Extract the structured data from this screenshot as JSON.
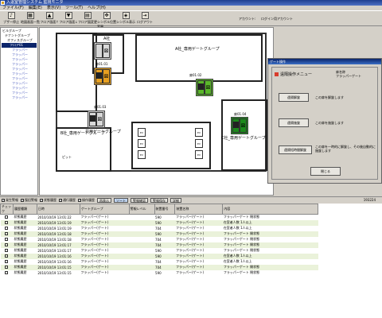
{
  "app": {
    "title": "入退室管理システム 監視モニタ"
  },
  "menu": [
    "ファイル(F)",
    "編集(E)",
    "表示(V)",
    "ツール(T)",
    "ヘルプ(H)"
  ],
  "toolbar": {
    "buttons": [
      "ブザー停止",
      "地図画面一覧",
      "フロア画面↑",
      "フロア画面↓",
      "フロア図変更",
      "シンボル位置変更",
      "シンボル表示",
      "ログアウト"
    ],
    "account_label": "アカウント:",
    "account_value": "ログイン用アカウント"
  },
  "tree": [
    {
      "label": "ビルグループ",
      "indent": 0,
      "selected": false
    },
    {
      "label": "テナントグループ",
      "indent": 1,
      "selected": false
    },
    {
      "label": "オフィスグループ",
      "indent": 2,
      "selected": false
    },
    {
      "label": "フロア01",
      "indent": 3,
      "selected": true
    },
    {
      "label": "フラッパー",
      "indent": 4,
      "selected": false
    },
    {
      "label": "フラッパー",
      "indent": 4,
      "selected": false
    },
    {
      "label": "フラッパー",
      "indent": 4,
      "selected": false
    },
    {
      "label": "フラッパー",
      "indent": 4,
      "selected": false
    },
    {
      "label": "フラッパー",
      "indent": 4,
      "selected": false
    },
    {
      "label": "フラッパー",
      "indent": 4,
      "selected": false
    },
    {
      "label": "フラッパー",
      "indent": 4,
      "selected": false
    },
    {
      "label": "フラッパー",
      "indent": 4,
      "selected": false
    },
    {
      "label": "フラッパー",
      "indent": 4,
      "selected": false
    },
    {
      "label": "フラッパー",
      "indent": 4,
      "selected": false
    },
    {
      "label": "フラッパー",
      "indent": 4,
      "selected": false
    }
  ],
  "map": {
    "labels": {
      "room_a": "A社",
      "group_a": "A社_専用ゲートグループ",
      "group_b": "B社_専用ゲートグループ",
      "group_common": "共用ゲートグループ",
      "group_c": "C社_専用ゲートグループ",
      "pit": "ピット",
      "ev": "EV"
    },
    "gates": [
      {
        "id": "扉01.01",
        "state": "plain"
      },
      {
        "id": "扉01.01",
        "state": "orange"
      },
      {
        "id": "扉01.02",
        "state": "green"
      },
      {
        "id": "扉01.03",
        "state": "plain"
      },
      {
        "id": "扉01.04",
        "state": "dgreen"
      }
    ]
  },
  "dialog": {
    "title": "ゲート操作",
    "heading": "遠隔操作メニュー",
    "gate_label": "扉名称",
    "gate_value": "フラッパーゲート",
    "buttons": [
      {
        "label": "遠隔解錠",
        "desc": "この扉を解錠します"
      },
      {
        "label": "遠隔施錠",
        "desc": "この扉を施錠します"
      },
      {
        "label": "遠隔短時間解錠",
        "desc": "この扉を一時的に解錠し、その後自動的に施錠します"
      }
    ],
    "close": "閉じる"
  },
  "filters": {
    "checks": [
      "発生警報",
      "復旧警報",
      "状態履歴",
      "通行履歴",
      "操作履歴"
    ],
    "buttons": [
      "再表示",
      "ソート",
      "警報確認",
      "警報保存",
      "詳細"
    ],
    "count": "193224"
  },
  "table": {
    "headers": [
      "チェック",
      "履歴種類",
      "日時",
      "ゲートグループ",
      "警報レベル",
      "装置番号",
      "装置名称",
      "内容"
    ],
    "rows": [
      [
        "状態履歴",
        "2010/10/19 13:01:22",
        "フラッパー(ゲート)",
        "",
        "590",
        "フラッパー(ゲート)",
        "フラッパーゲート 閉状態"
      ],
      [
        "状態履歴",
        "2010/10/19 13:01:19",
        "フラッパー(ゲート)",
        "",
        "590",
        "フラッパー(ゲート)",
        "在室者人数 1人以上"
      ],
      [
        "状態履歴",
        "2010/10/19 13:01:19",
        "フラッパー(ゲート)",
        "",
        "704",
        "フラッパー(ゲート)",
        "在室者人数 1人以上"
      ],
      [
        "状態履歴",
        "2010/10/19 13:01:18",
        "フラッパー(ゲート)",
        "",
        "590",
        "フラッパー(ゲート)",
        "フラッパーゲート 開状態"
      ],
      [
        "状態履歴",
        "2010/10/19 13:01:18",
        "フラッパー(ゲート)",
        "",
        "704",
        "フラッパー(ゲート)",
        "フラッパーゲート 閉状態"
      ],
      [
        "状態履歴",
        "2010/10/19 13:01:17",
        "フラッパー(ゲート)",
        "",
        "704",
        "フラッパー(ゲート)",
        "フラッパーゲート 開状態"
      ],
      [
        "状態履歴",
        "2010/10/19 13:01:17",
        "フラッパー(ゲート)",
        "",
        "590",
        "フラッパー(ゲート)",
        "フラッパーゲート 閉状態"
      ],
      [
        "状態履歴",
        "2010/10/19 13:01:16",
        "フラッパー(ゲート)",
        "",
        "590",
        "フラッパー(ゲート)",
        "在室者人数 1人以上"
      ],
      [
        "状態履歴",
        "2010/10/19 13:01:16",
        "フラッパー(ゲート)",
        "",
        "704",
        "フラッパー(ゲート)",
        "在室者人数 1人以上"
      ],
      [
        "状態履歴",
        "2010/10/19 13:01:15",
        "フラッパー(ゲート)",
        "",
        "704",
        "フラッパー(ゲート)",
        "フラッパーゲート 開状態"
      ],
      [
        "状態履歴",
        "2010/10/19 13:01:15",
        "フラッパー(ゲート)",
        "",
        "590",
        "フラッパー(ゲート)",
        "フラッパーゲート 閉状態"
      ]
    ]
  }
}
